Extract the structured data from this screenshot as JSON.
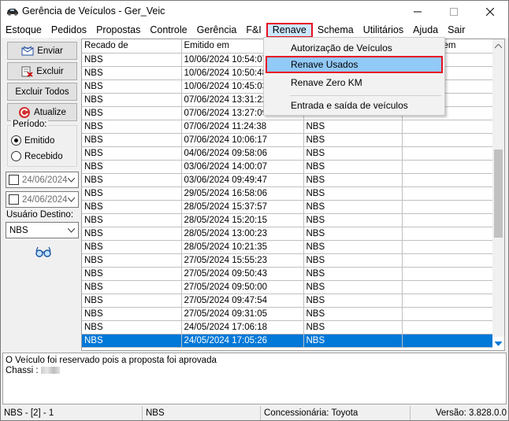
{
  "window": {
    "title": "Gerência de Veículos - Ger_Veic",
    "app_icon": "car-icon"
  },
  "menubar": [
    {
      "label": "Estoque"
    },
    {
      "label": "Pedidos"
    },
    {
      "label": "Propostas"
    },
    {
      "label": "Controle"
    },
    {
      "label": "Gerência"
    },
    {
      "label": "F&I"
    },
    {
      "label": "Renave",
      "active": true
    },
    {
      "label": "Schema"
    },
    {
      "label": "Utilitários"
    },
    {
      "label": "Ajuda"
    },
    {
      "label": "Sair"
    }
  ],
  "renave_menu": {
    "items": [
      {
        "label": "Autorização de Veículos"
      },
      {
        "label": "Renave Usados",
        "highlighted": true
      },
      {
        "label": "Renave Zero KM"
      },
      {
        "label": "Entrada e saída de veículos"
      }
    ]
  },
  "left_panel": {
    "buttons": {
      "enviar": "Enviar",
      "excluir": "Excluir",
      "excluir_todos": "Excluir Todos",
      "atualize": "Atualize"
    },
    "periodo": {
      "label": "Período:",
      "options": {
        "emitido": "Emitido",
        "recebido": "Recebido"
      },
      "selected": "Emitido"
    },
    "date_from": "24/06/2024",
    "date_to": "24/06/2024",
    "usuario_destino": {
      "label": "Usuário Destino:",
      "value": "NBS"
    },
    "icons": {
      "glasses": "glasses-icon"
    }
  },
  "grid": {
    "columns": [
      "Recado de",
      "Emitido em",
      "",
      "em"
    ],
    "rows": [
      {
        "de": "NBS",
        "emitido": "10/06/2024 10:54:07",
        "para": ""
      },
      {
        "de": "NBS",
        "emitido": "10/06/2024 10:50:48",
        "para": ""
      },
      {
        "de": "NBS",
        "emitido": "10/06/2024 10:45:03",
        "para": ""
      },
      {
        "de": "NBS",
        "emitido": "07/06/2024 13:31:22",
        "para": ""
      },
      {
        "de": "NBS",
        "emitido": "07/06/2024 13:27:09",
        "para": ""
      },
      {
        "de": "NBS",
        "emitido": "07/06/2024 11:24:38",
        "para": "NBS"
      },
      {
        "de": "NBS",
        "emitido": "07/06/2024 10:06:17",
        "para": "NBS"
      },
      {
        "de": "NBS",
        "emitido": "04/06/2024 09:58:06",
        "para": "NBS"
      },
      {
        "de": "NBS",
        "emitido": "03/06/2024 14:00:07",
        "para": "NBS"
      },
      {
        "de": "NBS",
        "emitido": "03/06/2024 09:49:47",
        "para": "NBS"
      },
      {
        "de": "NBS",
        "emitido": "29/05/2024 16:58:06",
        "para": "NBS"
      },
      {
        "de": "NBS",
        "emitido": "28/05/2024 15:37:57",
        "para": "NBS"
      },
      {
        "de": "NBS",
        "emitido": "28/05/2024 15:20:15",
        "para": "NBS"
      },
      {
        "de": "NBS",
        "emitido": "28/05/2024 13:00:23",
        "para": "NBS"
      },
      {
        "de": "NBS",
        "emitido": "28/05/2024 10:21:35",
        "para": "NBS"
      },
      {
        "de": "NBS",
        "emitido": "27/05/2024 15:55:23",
        "para": "NBS"
      },
      {
        "de": "NBS",
        "emitido": "27/05/2024 09:50:43",
        "para": "NBS"
      },
      {
        "de": "NBS",
        "emitido": "27/05/2024 09:50:00",
        "para": "NBS"
      },
      {
        "de": "NBS",
        "emitido": "27/05/2024 09:47:54",
        "para": "NBS"
      },
      {
        "de": "NBS",
        "emitido": "27/05/2024 09:31:05",
        "para": "NBS"
      },
      {
        "de": "NBS",
        "emitido": "24/05/2024 17:06:18",
        "para": "NBS"
      },
      {
        "de": "NBS",
        "emitido": "24/05/2024 17:05:26",
        "para": "NBS",
        "selected": true
      }
    ]
  },
  "message": {
    "line1": "O Veículo foi reservado pois a proposta foi aprovada",
    "line2": "Chassi :"
  },
  "statusbar": {
    "user": "NBS - [2] - 1",
    "company": "NBS",
    "dealer": "Concessionária: Toyota",
    "version": "Versão: 3.828.0.0"
  },
  "colors": {
    "selection": "#0078d7",
    "menu_highlight": "#91c9f7",
    "annotation_red": "#e81123"
  }
}
